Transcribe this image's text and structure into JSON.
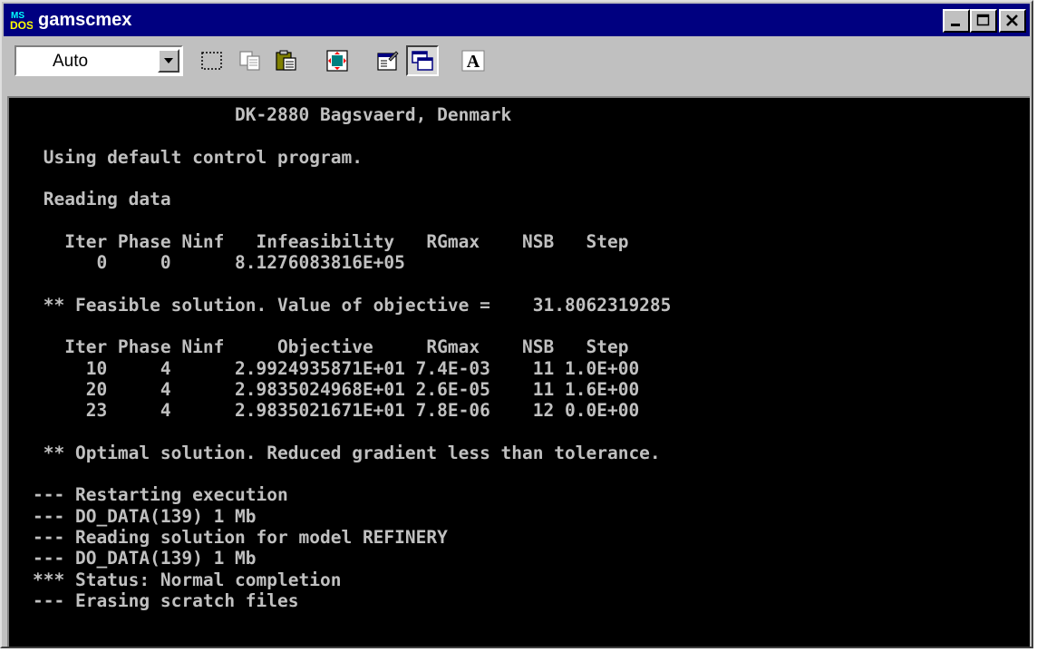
{
  "window": {
    "title": "gamscmex",
    "controls": [
      "minimize-icon",
      "maximize-icon",
      "close-icon"
    ]
  },
  "toolbar": {
    "font_select_value": "Auto",
    "font_button_label": "A",
    "tools": [
      "mark-icon",
      "copy-icon",
      "paste-icon",
      "fullscreen-icon",
      "properties-icon",
      "background-icon",
      "font-icon"
    ]
  },
  "console": {
    "text_color": "#c0c0c0",
    "background": "#000000",
    "lines": [
      "                   DK-2880 Bagsvaerd, Denmark",
      "",
      " Using default control program.",
      "",
      " Reading data",
      "",
      "   Iter Phase Ninf   Infeasibility   RGmax    NSB   Step",
      "      0     0      8.1276083816E+05",
      "",
      " ** Feasible solution. Value of objective =    31.8062319285",
      "",
      "   Iter Phase Ninf     Objective     RGmax    NSB   Step",
      "     10     4      2.9924935871E+01 7.4E-03    11 1.0E+00",
      "     20     4      2.9835024968E+01 2.6E-05    11 1.6E+00",
      "     23     4      2.9835021671E+01 7.8E-06    12 0.0E+00",
      "",
      " ** Optimal solution. Reduced gradient less than tolerance.",
      "",
      "--- Restarting execution",
      "--- DO_DATA(139) 1 Mb",
      "--- Reading solution for model REFINERY",
      "--- DO_DATA(139) 1 Mb",
      "*** Status: Normal completion",
      "--- Erasing scratch files"
    ]
  }
}
